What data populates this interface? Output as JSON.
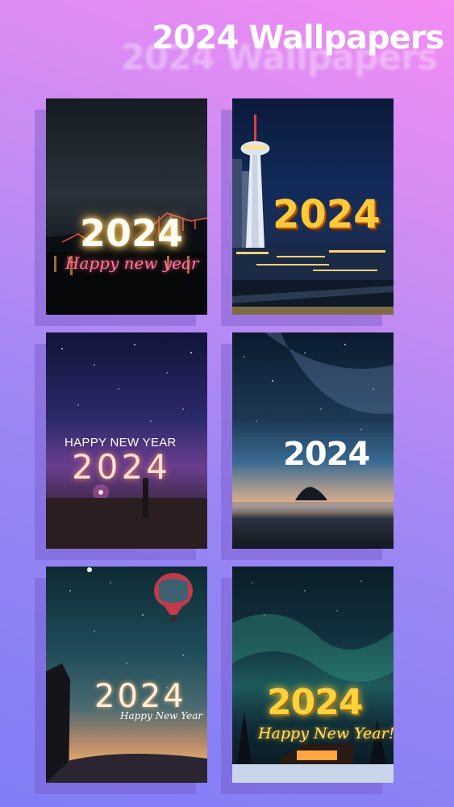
{
  "header": {
    "title": "2024 Wallpapers"
  },
  "wallpapers": [
    {
      "year_text": "2024",
      "caption": "Happy new year"
    },
    {
      "year_text": "2024",
      "caption": ""
    },
    {
      "year_text": "2024",
      "caption": "HAPPY NEW YEAR"
    },
    {
      "year_text": "2024",
      "caption": ""
    },
    {
      "year_text": "2024",
      "caption": "Happy New Year"
    },
    {
      "year_text": "2024",
      "caption": "Happy New Year!"
    }
  ],
  "colors": {
    "background_top": "#f48cf4",
    "background_bottom": "#7f7df6",
    "title": "#ffffff"
  }
}
